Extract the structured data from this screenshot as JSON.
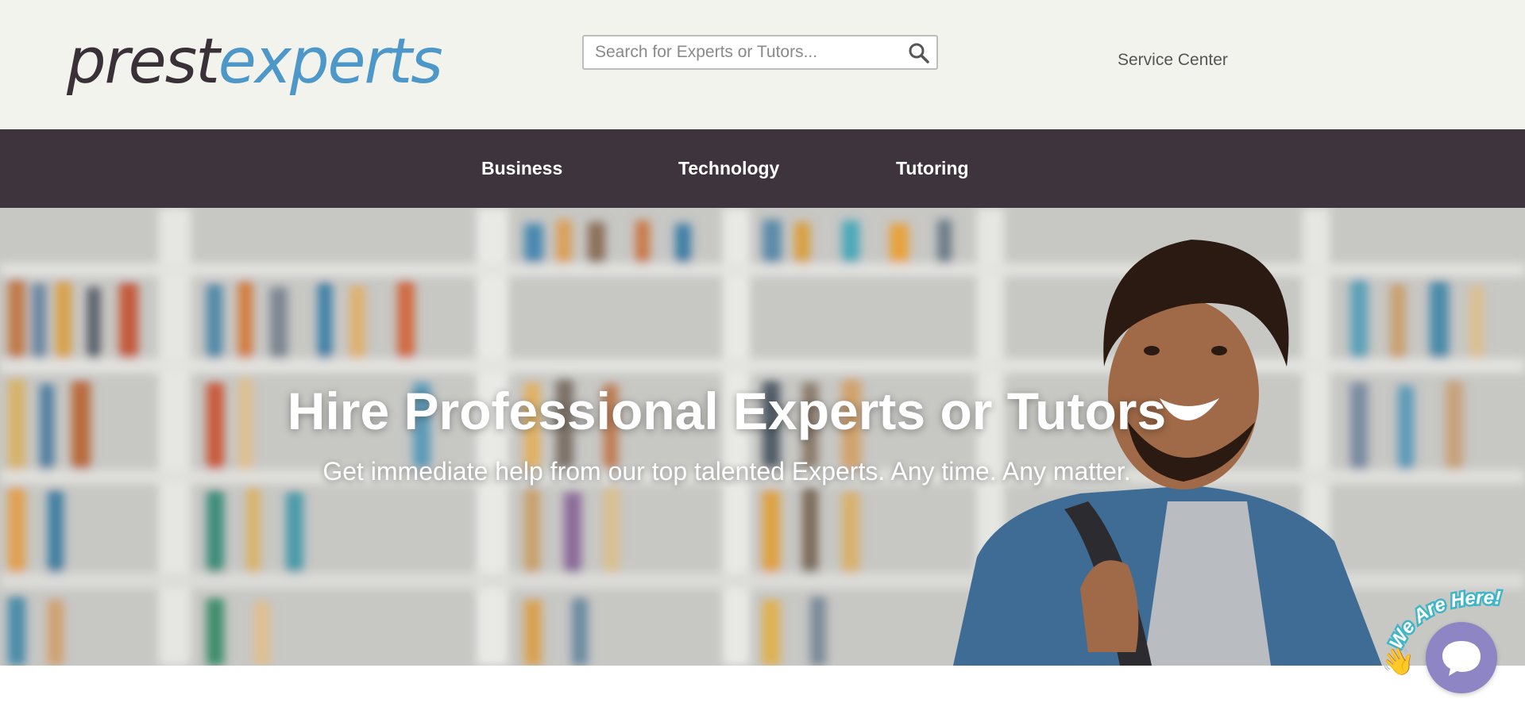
{
  "header": {
    "logo": {
      "part1": "prest",
      "part2": "experts"
    },
    "search": {
      "placeholder": "Search for Experts or Tutors...",
      "icon": "search-icon"
    },
    "service_center": "Service Center"
  },
  "nav": {
    "items": [
      {
        "label": "Business"
      },
      {
        "label": "Technology"
      },
      {
        "label": "Tutoring"
      }
    ]
  },
  "hero": {
    "title": "Hire Professional Experts or Tutors",
    "subtitle": "Get immediate help from our top talented Experts. Any time. Any matter."
  },
  "chat": {
    "label": "We Are Here!",
    "icon": "chat-bubble-icon",
    "wave": "👋"
  },
  "colors": {
    "header_bg": "#f3f3ee",
    "nav_bg": "#3e343e",
    "brand_dark": "#3a3138",
    "brand_blue": "#4d98c9",
    "chat_accent": "#8e86c4"
  }
}
